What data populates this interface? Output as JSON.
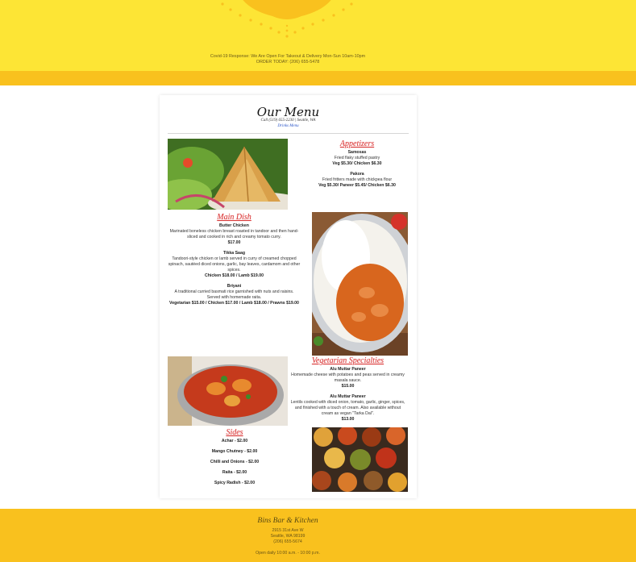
{
  "header": {
    "covid_line": "Covid-19 Response: We Are Open For Takeout & Delivery Mon-Sun 10am-10pm",
    "order_line": "ORDER TODAY: (206) 655-5478",
    "colors": {
      "header_bg": "#fde535",
      "band": "#f9c11e",
      "ornament": "#f9c11e"
    }
  },
  "menu": {
    "title": "Our Menu",
    "call_line": "Call (519) 655-2230 | Seattle, WA",
    "drinks_link": "Drinks Menu",
    "appetizers": {
      "heading": "Appetizers",
      "items": [
        {
          "name": "Samosas",
          "desc": "Fried flaky stuffed pastry",
          "price": "Veg $5.30/ Chicken $6.30"
        },
        {
          "name": "Pakora",
          "desc": "Fried fritters made with chickpea flour",
          "price": "Veg $5.30/ Paneer $5.45/ Chicken $6.30"
        }
      ]
    },
    "main_dish": {
      "heading": "Main Dish",
      "items": [
        {
          "name": "Butter Chicken",
          "desc": "Marinated boneless chicken breast roasted in tandoor and then hand-sliced and cooked in rich and creamy tomato curry.",
          "price": "$17.00"
        },
        {
          "name": "Tikka Saag",
          "desc": "Tandoori-style chicken or lamb served in curry of creamed chopped spinach, sautéed diced onions, garlic, bay leaves, cardamom and other spices.",
          "price": "Chicken $18.00 / Lamb $19.00"
        },
        {
          "name": "Briyani",
          "desc": "A traditional curried basmati rice garnished with nuts and raisins. Served with homemade raita.",
          "price": "Vegetarian $15.00 / Chicken $17.00 / Lamb $18.00 / Prawns $19.00"
        }
      ]
    },
    "vegetarian": {
      "heading": "Vegetarian Specialties",
      "items": [
        {
          "name": "Alu Muttar Paneer",
          "desc": "Homemade cheese with potatoes and peas served in creamy masala sauce.",
          "price": "$15.00"
        },
        {
          "name": "Alu Muttar Paneer",
          "desc": "Lentils cooked with diced onion, tomato, garlic, ginger, spices, and finished with a touch of cream. Also available without cream as vegan \"Tarka Dal\".",
          "price": "$13.00"
        }
      ]
    },
    "sides": {
      "heading": "Sides",
      "items": [
        "Achar - $2.00",
        "Mango Chutney - $2.00",
        "Chilli and Onions - $2.00",
        "Raita - $2.00",
        "Spicy Radish - $2.00"
      ]
    },
    "colors": {
      "section_heading": "#d93a3a",
      "link": "#2a55c8"
    }
  },
  "footer": {
    "brand": "Bins Bar & Kitchen",
    "address1": "2915 31st Ave W",
    "address2": "Seattle, WA 98199",
    "phone": "(206) 655-5674",
    "hours": "Open daily 10:00 a.m. - 10:00 p.m."
  }
}
